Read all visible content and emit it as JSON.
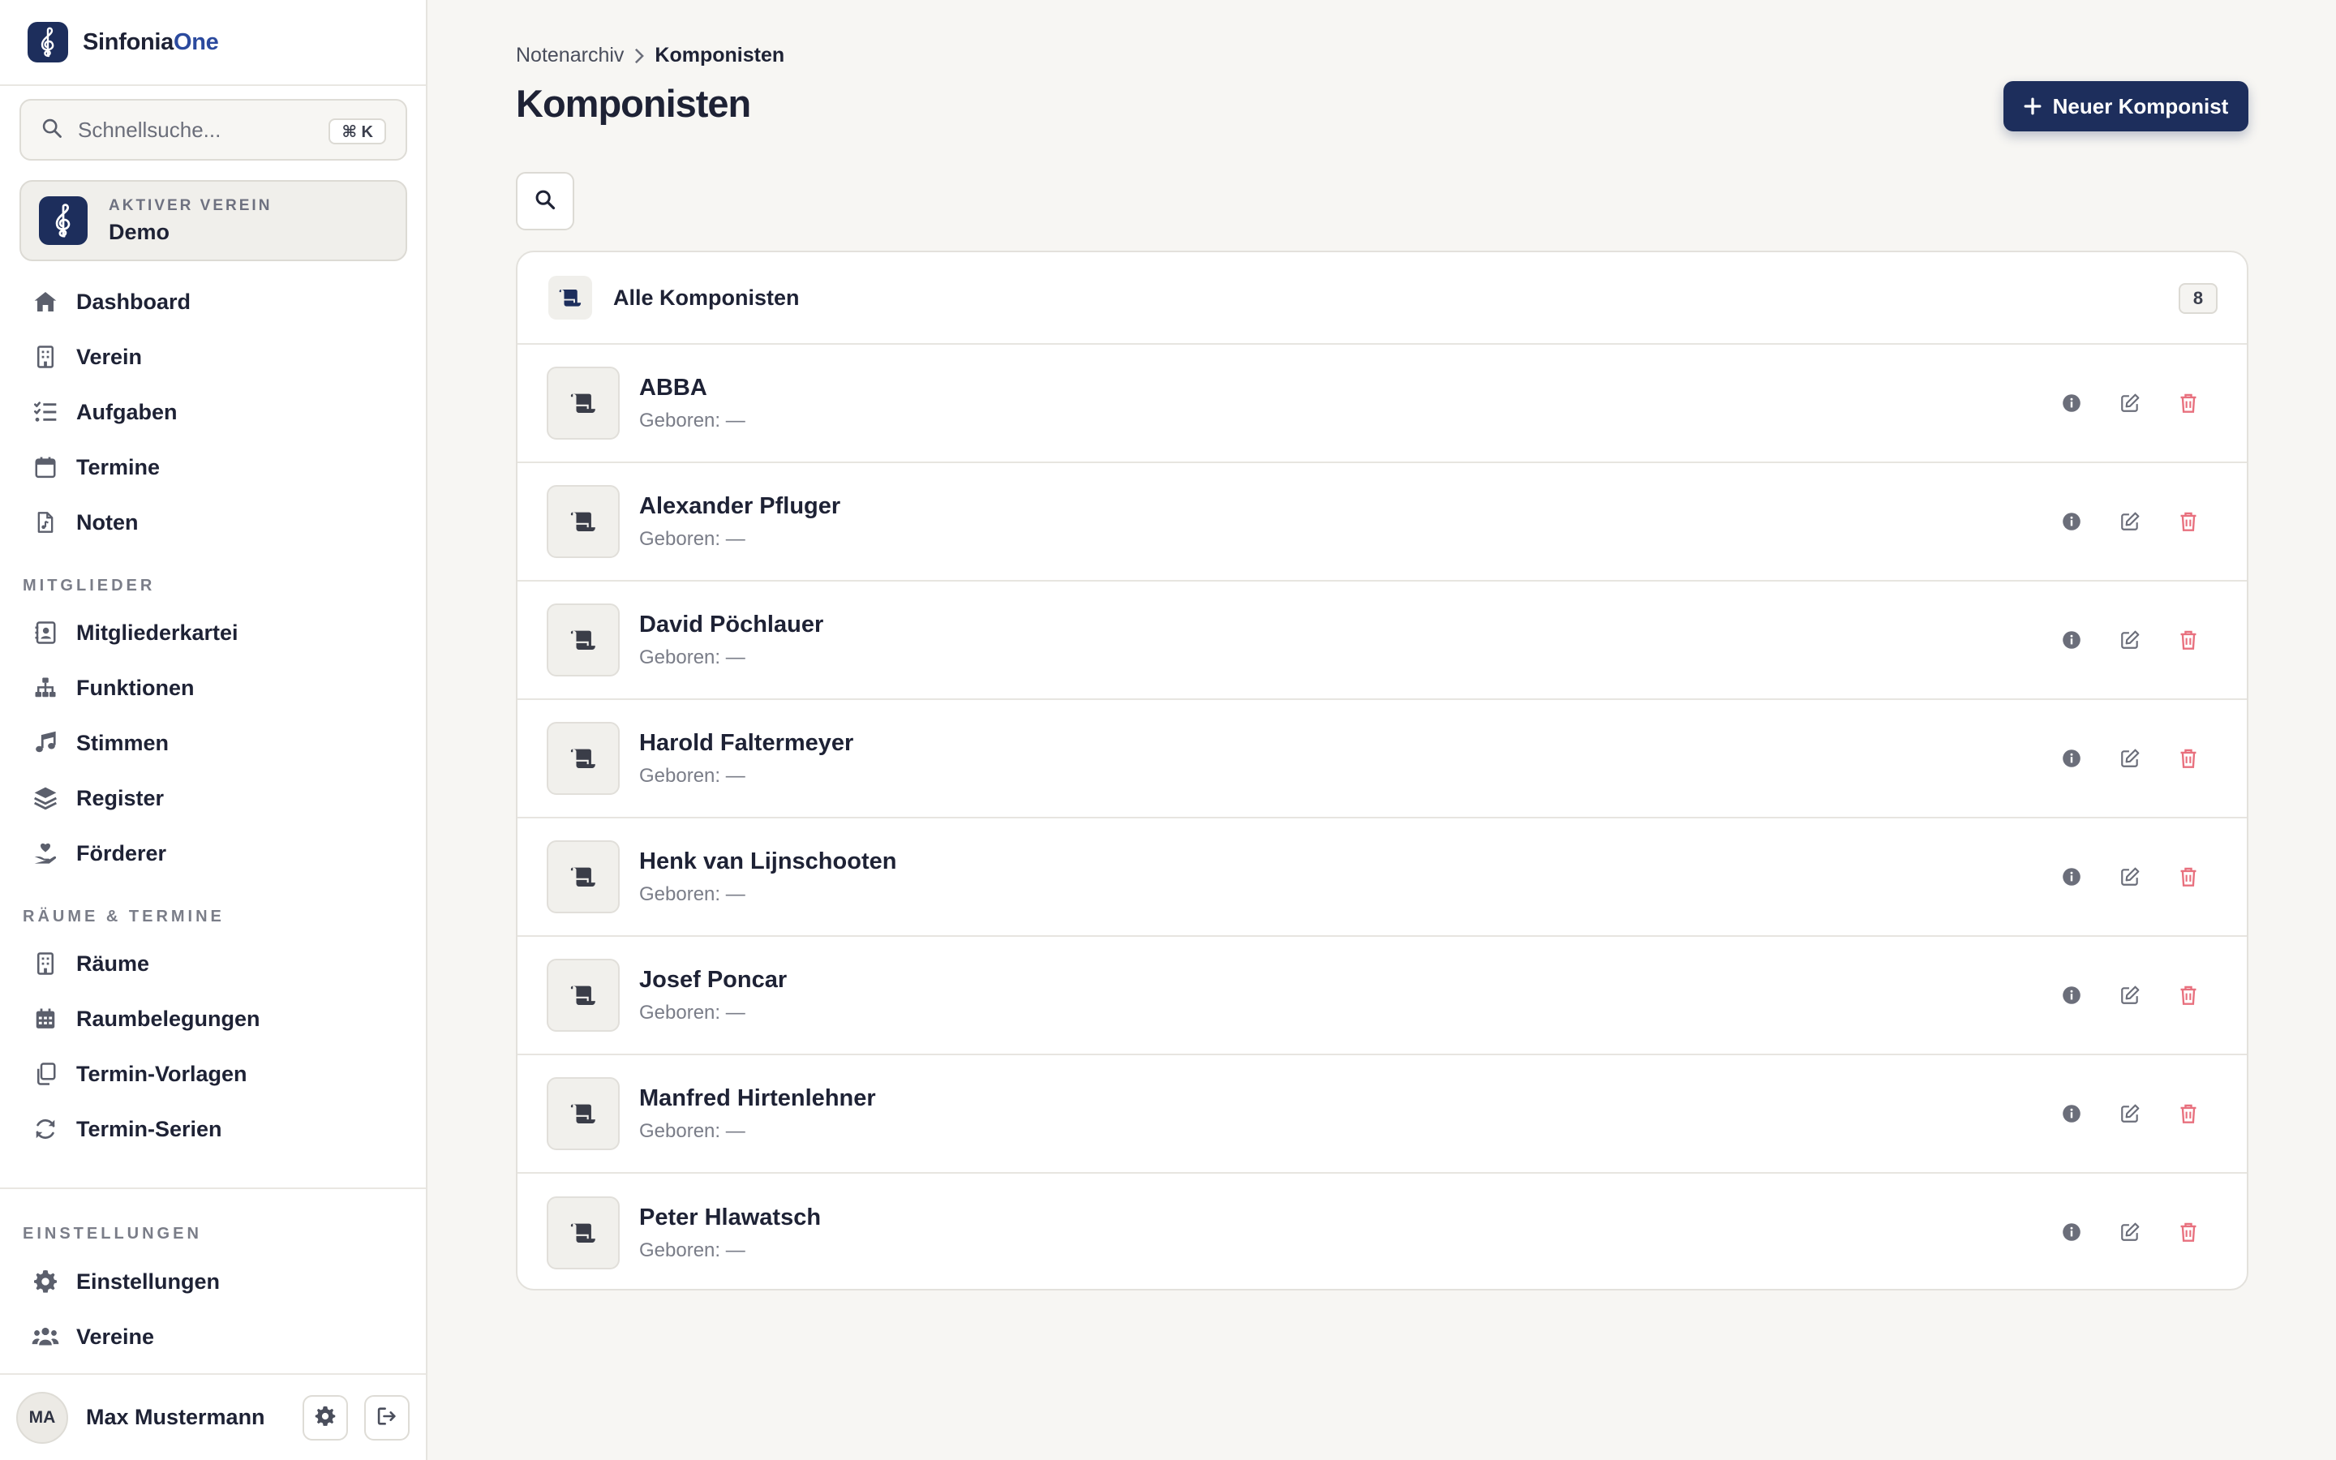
{
  "app": {
    "name_main": "Sinfonia",
    "name_accent": "One",
    "brand_color": "#1d2e5c"
  },
  "sidebar": {
    "search_placeholder": "Schnellsuche...",
    "search_shortcut": "⌘ K",
    "club_label": "AKTIVER VEREIN",
    "club_name": "Demo",
    "main_nav": [
      {
        "label": "Dashboard",
        "icon": "home-icon"
      },
      {
        "label": "Verein",
        "icon": "building-icon"
      },
      {
        "label": "Aufgaben",
        "icon": "list-check-icon"
      },
      {
        "label": "Termine",
        "icon": "calendar-icon"
      },
      {
        "label": "Noten",
        "icon": "sheet-music-icon"
      }
    ],
    "section_members": "MITGLIEDER",
    "members_nav": [
      {
        "label": "Mitgliederkartei",
        "icon": "contact-card-icon"
      },
      {
        "label": "Funktionen",
        "icon": "org-chart-icon"
      },
      {
        "label": "Stimmen",
        "icon": "music-note-icon"
      },
      {
        "label": "Register",
        "icon": "layers-icon"
      },
      {
        "label": "Förderer",
        "icon": "hand-heart-icon"
      }
    ],
    "section_rooms": "RÄUME & TERMINE",
    "rooms_nav": [
      {
        "label": "Räume",
        "icon": "building-icon"
      },
      {
        "label": "Raumbelegungen",
        "icon": "calendar-grid-icon"
      },
      {
        "label": "Termin-Vorlagen",
        "icon": "copy-icon"
      },
      {
        "label": "Termin-Serien",
        "icon": "refresh-icon"
      }
    ],
    "section_settings": "EINSTELLUNGEN",
    "settings_nav": [
      {
        "label": "Einstellungen",
        "icon": "gear-icon"
      },
      {
        "label": "Vereine",
        "icon": "users-icon"
      }
    ],
    "user_initials": "MA",
    "user_name": "Max Mustermann"
  },
  "main": {
    "breadcrumb": [
      "Notenarchiv",
      "Komponisten"
    ],
    "title": "Komponisten",
    "new_button": "Neuer Komponist",
    "list_title": "Alle Komponisten",
    "count": "8",
    "composers": [
      {
        "name": "ABBA",
        "born": "Geboren: —"
      },
      {
        "name": "Alexander Pfluger",
        "born": "Geboren: —"
      },
      {
        "name": "David Pöchlauer",
        "born": "Geboren: —"
      },
      {
        "name": "Harold Faltermeyer",
        "born": "Geboren: —"
      },
      {
        "name": "Henk van Lijnschooten",
        "born": "Geboren: —"
      },
      {
        "name": "Josef Poncar",
        "born": "Geboren: —"
      },
      {
        "name": "Manfred Hirtenlehner",
        "born": "Geboren: —"
      },
      {
        "name": "Peter Hlawatsch",
        "born": "Geboren: —"
      }
    ]
  },
  "colors": {
    "text": "#1e2235",
    "muted": "#7a7d88",
    "danger": "#e8707e",
    "background": "#f7f6f3"
  }
}
